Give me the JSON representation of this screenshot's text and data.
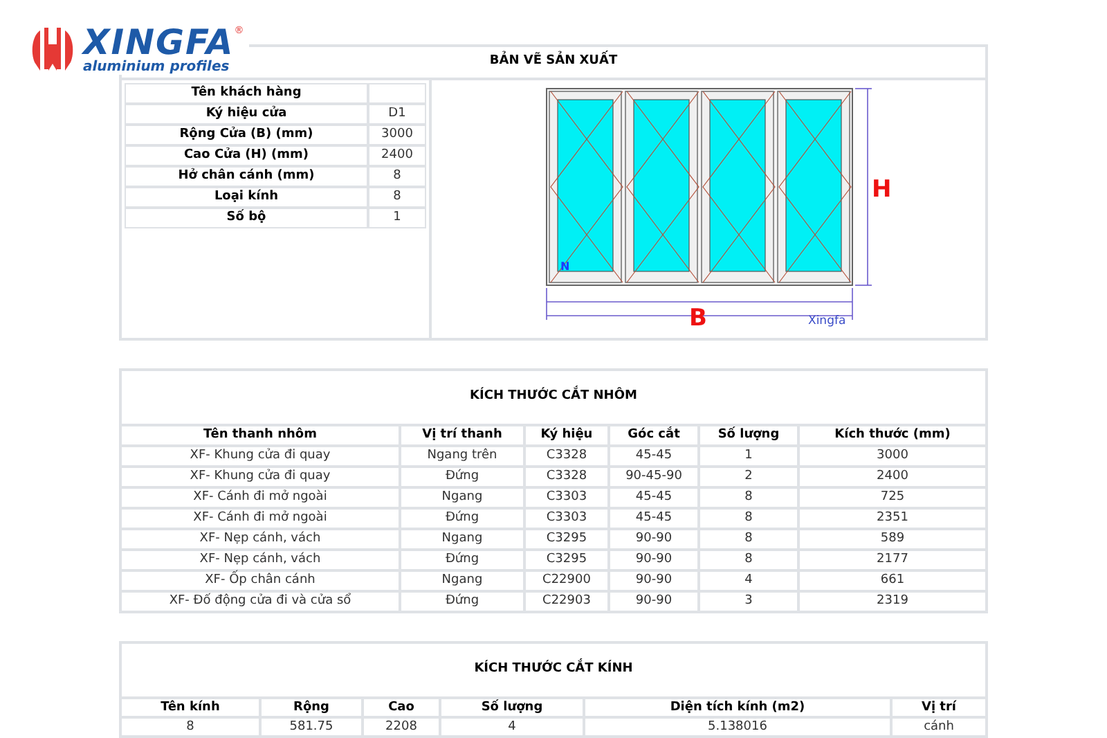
{
  "logo": {
    "brand": "XINGFA",
    "registered": "®",
    "tagline": "aluminium profiles"
  },
  "production_drawing": {
    "title": "BẢN VẼ SẢN XUẤT",
    "specs": [
      {
        "label": "Tên khách hàng"
      },
      {
        "label": "Ký hiệu cửa",
        "value": "D1"
      },
      {
        "label": "Rộng Cửa (B) (mm)",
        "value": "3000"
      },
      {
        "label": "Cao Cửa (H) (mm)",
        "value": "2400"
      },
      {
        "label": "Hở chân cánh (mm)",
        "value": "8"
      },
      {
        "label": "Loại kính",
        "value": "8"
      },
      {
        "label": "Số bộ",
        "value": "1"
      }
    ],
    "drawing": {
      "height_label": "H",
      "width_label": "B",
      "panel_mark": "N",
      "caption": "Xingfa"
    }
  },
  "aluminium_cuts": {
    "title": "KÍCH THƯỚC CẮT NHÔM",
    "columns": [
      "Tên thanh nhôm",
      "Vị trí thanh",
      "Ký hiệu",
      "Góc cắt",
      "Số lượng",
      "Kích thước (mm)"
    ],
    "rows": [
      [
        "XF- Khung cửa đi quay",
        "Ngang trên",
        "C3328",
        "45-45",
        "1",
        "3000"
      ],
      [
        "XF- Khung cửa đi quay",
        "Đứng",
        "C3328",
        "90-45-90",
        "2",
        "2400"
      ],
      [
        "XF- Cánh đi mở ngoài",
        "Ngang",
        "C3303",
        "45-45",
        "8",
        "725"
      ],
      [
        "XF- Cánh đi mở ngoài",
        "Đứng",
        "C3303",
        "45-45",
        "8",
        "2351"
      ],
      [
        "XF- Nẹp cánh, vách",
        "Ngang",
        "C3295",
        "90-90",
        "8",
        "589"
      ],
      [
        "XF- Nẹp cánh, vách",
        "Đứng",
        "C3295",
        "90-90",
        "8",
        "2177"
      ],
      [
        "XF- Ốp chân cánh",
        "Ngang",
        "C22900",
        "90-90",
        "4",
        "661"
      ],
      [
        "XF- Đố động cửa đi và cửa sổ",
        "Đứng",
        "C22903",
        "90-90",
        "3",
        "2319"
      ]
    ]
  },
  "glass_cuts": {
    "title": "KÍCH THƯỚC CẮT KÍNH",
    "columns": [
      "Tên kính",
      "Rộng",
      "Cao",
      "Số lượng",
      "Diện tích kính (m2)",
      "Vị trí"
    ],
    "rows": [
      [
        "8",
        "581.75",
        "2208",
        "4",
        "5.138016",
        "cánh"
      ]
    ]
  }
}
